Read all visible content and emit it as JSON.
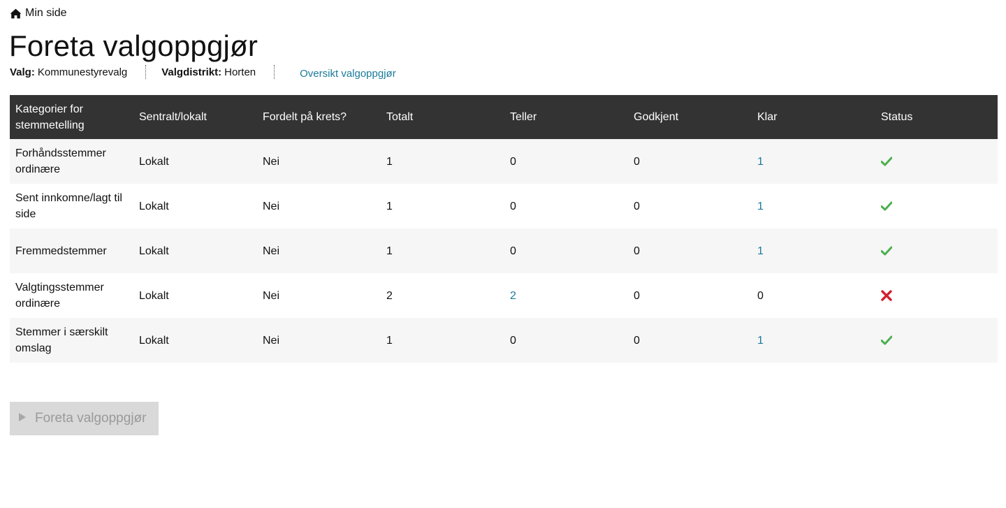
{
  "breadcrumb": {
    "icon": "home-icon",
    "label": "Min side"
  },
  "page": {
    "title": "Foreta valgoppgjør"
  },
  "meta": {
    "election_label": "Valg:",
    "election_value": "Kommunestyrevalg",
    "district_label": "Valgdistrikt:",
    "district_value": "Horten",
    "overview_link": "Oversikt valgoppgjør"
  },
  "colors": {
    "header_bg": "#333333",
    "link": "#1a7a9a",
    "ok": "#4caf50",
    "error": "#d0202e",
    "button_bg": "#d9d9d9",
    "button_text": "#9a9a9a"
  },
  "table": {
    "headers": [
      "Kategorier for stemmetelling",
      "Sentralt/lokalt",
      "Fordelt på krets?",
      "Totalt",
      "Teller",
      "Godkjent",
      "Klar",
      "Status"
    ],
    "rows": [
      {
        "category": "Forhåndsstemmer ordinære",
        "scope": "Lokalt",
        "distributed": "Nei",
        "total": "1",
        "counting": "0",
        "approved": "0",
        "ready": "1",
        "status": "ok"
      },
      {
        "category": "Sent innkomne/lagt til side",
        "scope": "Lokalt",
        "distributed": "Nei",
        "total": "1",
        "counting": "0",
        "approved": "0",
        "ready": "1",
        "status": "ok"
      },
      {
        "category": "Fremmedstemmer",
        "scope": "Lokalt",
        "distributed": "Nei",
        "total": "1",
        "counting": "0",
        "approved": "0",
        "ready": "1",
        "status": "ok"
      },
      {
        "category": "Valgtingsstemmer ordinære",
        "scope": "Lokalt",
        "distributed": "Nei",
        "total": "2",
        "counting": "2",
        "approved": "0",
        "ready": "0",
        "status": "error"
      },
      {
        "category": "Stemmer i særskilt omslag",
        "scope": "Lokalt",
        "distributed": "Nei",
        "total": "1",
        "counting": "0",
        "approved": "0",
        "ready": "1",
        "status": "ok"
      }
    ]
  },
  "action": {
    "icon": "play-icon",
    "label": "Foreta valgoppgjør",
    "disabled": true
  }
}
